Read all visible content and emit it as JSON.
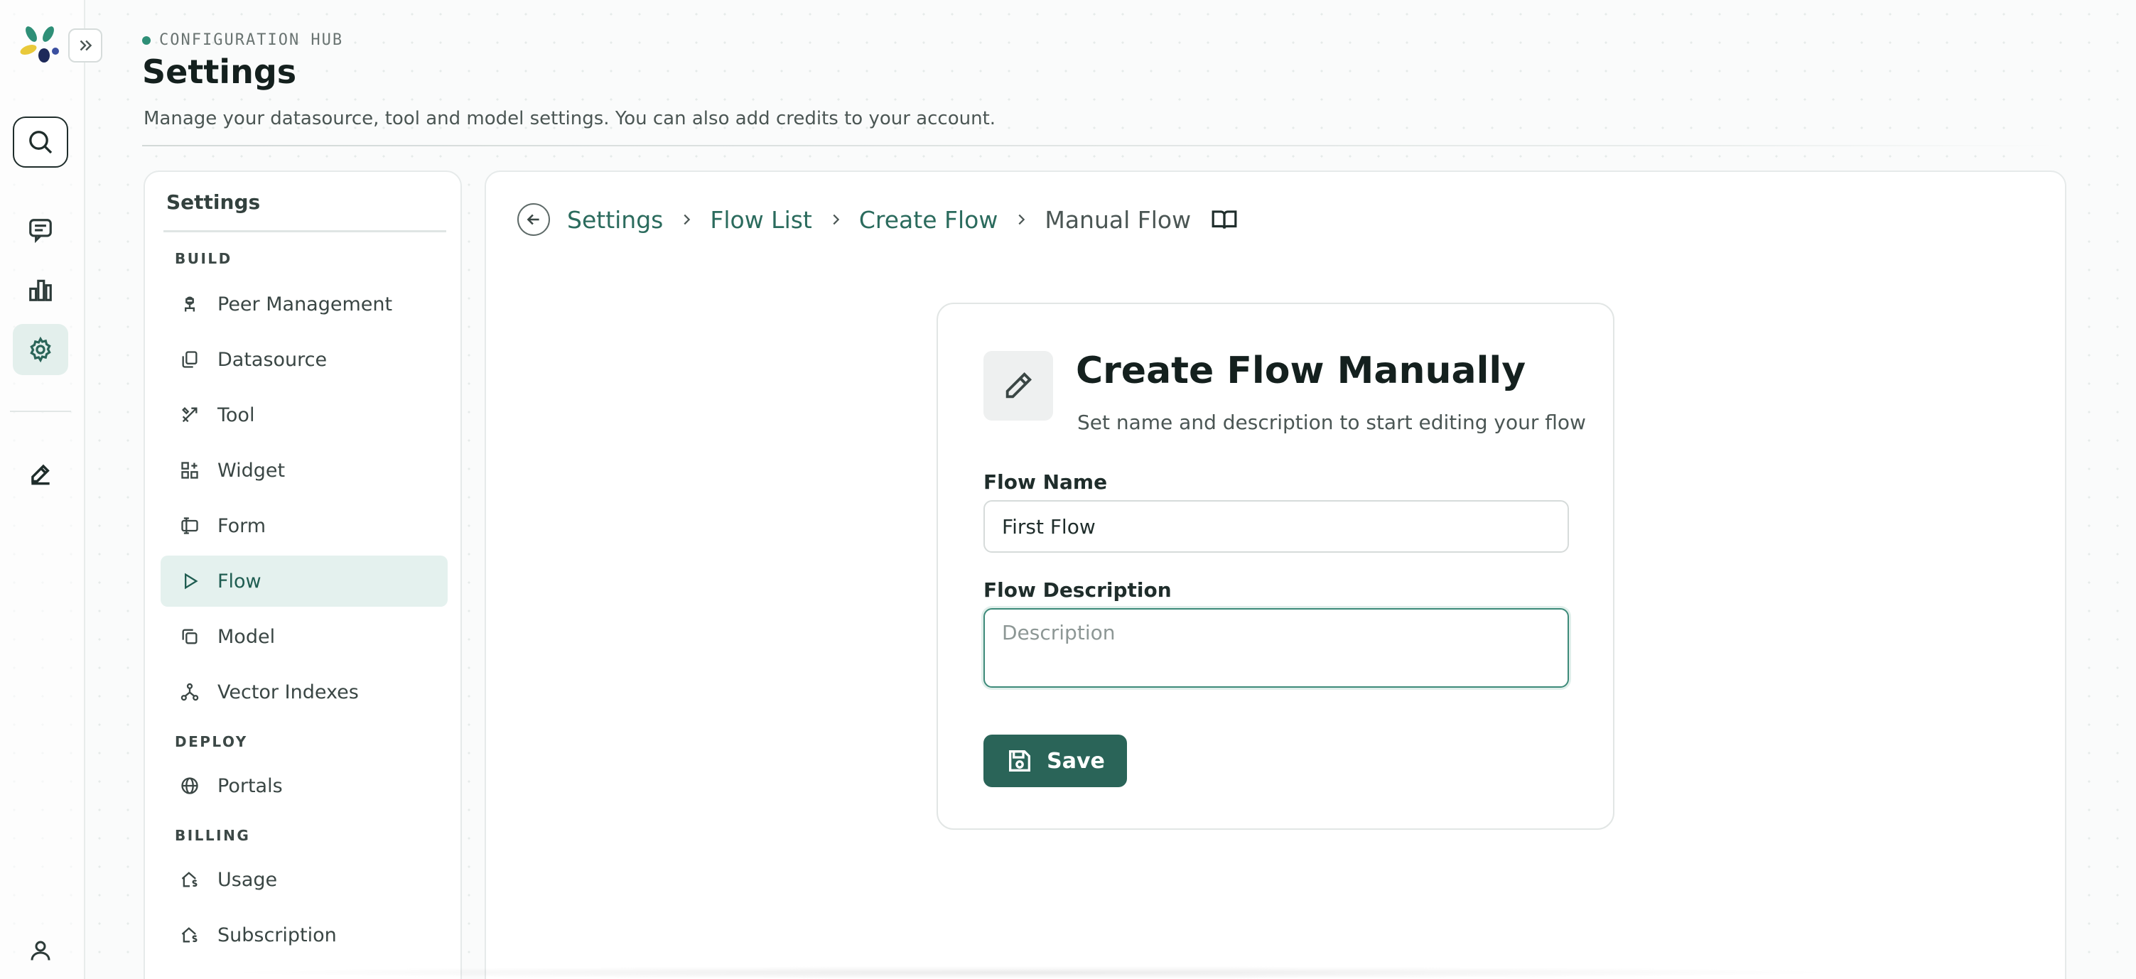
{
  "header": {
    "eyebrow": "CONFIGURATION HUB",
    "title": "Settings",
    "subtitle": "Manage your datasource, tool and model settings. You can also add credits to your account."
  },
  "rail": {
    "icons": [
      "logo-icon",
      "expand-icon",
      "search-icon",
      "chat-icon",
      "chart-icon",
      "gear-icon",
      "edit-icon",
      "user-icon"
    ],
    "active": "gear-icon"
  },
  "sidebar": {
    "title": "Settings",
    "sections": {
      "build": "BUILD",
      "deploy": "DEPLOY",
      "billing": "BILLING"
    },
    "items": [
      {
        "label": "Peer Management",
        "icon": "peer-icon"
      },
      {
        "label": "Datasource",
        "icon": "copy-icon"
      },
      {
        "label": "Tool",
        "icon": "tool-icon"
      },
      {
        "label": "Widget",
        "icon": "widget-icon"
      },
      {
        "label": "Form",
        "icon": "form-icon"
      },
      {
        "label": "Flow",
        "icon": "play-icon",
        "active": true
      },
      {
        "label": "Model",
        "icon": "model-icon"
      },
      {
        "label": "Vector Indexes",
        "icon": "vector-icon"
      },
      {
        "label": "Portals",
        "icon": "globe-icon"
      },
      {
        "label": "Usage",
        "icon": "usage-icon"
      },
      {
        "label": "Subscription",
        "icon": "subscription-icon"
      }
    ]
  },
  "breadcrumb": {
    "items": [
      "Settings",
      "Flow List",
      "Create Flow",
      "Manual Flow"
    ]
  },
  "card": {
    "title": "Create Flow Manually",
    "subtitle": "Set name and description to start editing your flow",
    "name_label": "Flow Name",
    "name_value": "First Flow",
    "description_label": "Flow Description",
    "description_placeholder": "Description",
    "save_label": "Save"
  },
  "colors": {
    "accent": "#2a6458",
    "active_bg": "#e4f1ee",
    "link": "#2b6b5d"
  }
}
